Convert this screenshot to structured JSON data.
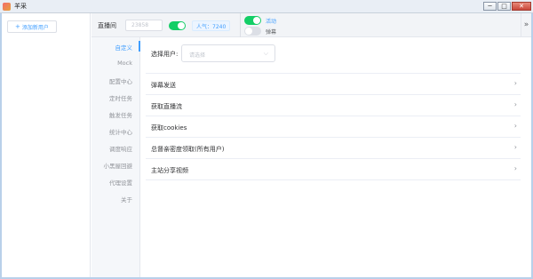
{
  "window": {
    "title": "羊采",
    "controls": [
      "─",
      "□",
      "✕"
    ]
  },
  "left_panel": {
    "add_user_icon": "+",
    "add_user_label": "添加新用户"
  },
  "header": {
    "room_label": "直播间",
    "room_value": "23858",
    "connect_switch_on": true,
    "popularity": "人气：7240",
    "activity_switch_on": true,
    "activity_label": "活动",
    "danmaku_switch_on": false,
    "danmaku_label": "弹幕",
    "collapse_icon": "»"
  },
  "tabs": [
    {
      "label": "自定义",
      "active": true
    },
    {
      "label": "Mock",
      "active": false
    },
    {
      "label": "配置中心",
      "active": false
    },
    {
      "label": "定时任务",
      "active": false
    },
    {
      "label": "触发任务",
      "active": false
    },
    {
      "label": "统计中心",
      "active": false
    },
    {
      "label": "调度响应",
      "active": false
    },
    {
      "label": "小黑屋回避",
      "active": false
    },
    {
      "label": "代理设置",
      "active": false
    },
    {
      "label": "关于",
      "active": false
    }
  ],
  "content": {
    "select_user_label": "选择用户:",
    "select_placeholder": "请选择",
    "select_arrow_icon": "chevron-down-icon",
    "rows": [
      {
        "label": "弹幕发送"
      },
      {
        "label": "获取直播流"
      },
      {
        "label": "获取cookies"
      },
      {
        "label": "总督亲密度领取(所有用户)"
      },
      {
        "label": "主站分享视频"
      }
    ],
    "row_arrow": "›"
  },
  "colors": {
    "accent": "#409eff",
    "switch_on": "#13ce66",
    "frame_border": "#b9d0ea"
  }
}
